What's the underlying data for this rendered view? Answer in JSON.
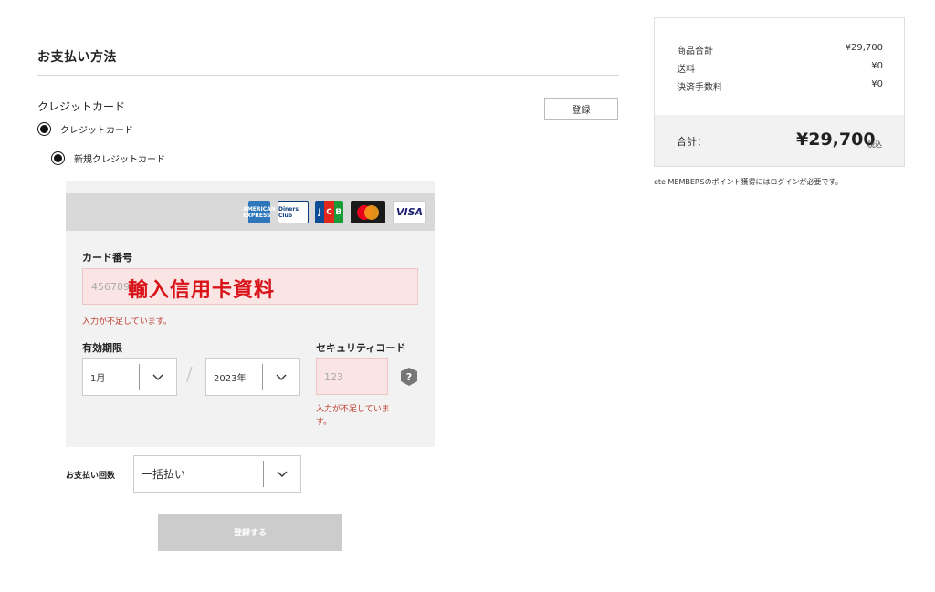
{
  "payment": {
    "section_title": "お支払い方法",
    "cc_heading": "クレジットカード",
    "register_label": "登録",
    "radio_credit_card": "クレジットカード",
    "radio_new_card": "新規クレジットカード"
  },
  "brands": {
    "amex": "AMERICAN EXPRESS",
    "diners": "Diners Club",
    "jcb": [
      "J",
      "C",
      "B"
    ],
    "visa": "VISA"
  },
  "card_form": {
    "card_number_label": "カード番号",
    "card_number_value": "4567891",
    "overlay_text": "輸入信用卡資料",
    "card_number_error": "入力が不足しています。",
    "expiry_label": "有効期限",
    "expiry_month": "1月",
    "expiry_year": "2023年",
    "slash": "/",
    "security_label": "セキュリティコード",
    "security_placeholder": "123",
    "help_symbol": "?",
    "security_error": "入力が不足しています。",
    "installments_label": "お支払い回数",
    "installments_value": "一括払い",
    "submit_label": "登録する"
  },
  "summary": {
    "rows": [
      {
        "label": "商品合計",
        "value": "¥29,700"
      },
      {
        "label": "送料",
        "value": "¥0"
      },
      {
        "label": "決済手数料",
        "value": "¥0"
      }
    ],
    "total_label": "合計：",
    "total_value": "¥29,700",
    "tax_label": "税込",
    "members_note": "ete MEMBERSのポイント獲得にはログインが必要です。"
  },
  "colors": {
    "error": "#c0392b",
    "overlay": "#d8131a",
    "input_error_bg": "#fbe4e4",
    "panel_bg": "#f2f2f2",
    "disabled_button": "#cccccc"
  }
}
